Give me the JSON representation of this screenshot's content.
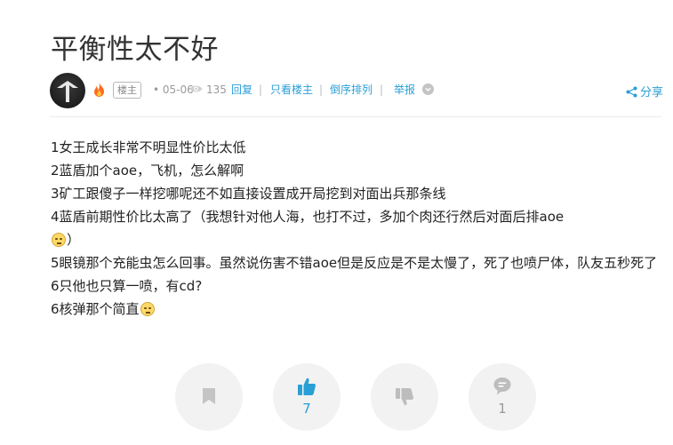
{
  "post": {
    "title": "平衡性太不好",
    "badge": "楼主",
    "date": "• 05-06",
    "views": "135",
    "reply": "回复",
    "only_op": "只看楼主",
    "reverse": "倒序排列",
    "report": "举报",
    "share": "分享",
    "sep": "|"
  },
  "content": {
    "line1": "1女王成长非常不明显性价比太低",
    "line2": "2蓝盾加个aoe，飞机，怎么解啊",
    "line3": "3矿工跟傻子一样挖哪呢还不如直接设置成开局挖到对面出兵那条线",
    "line4a": "4蓝盾前期性价比太高了（我想针对他人海，也打不过，多加个肉还行然后对面后排aoe",
    "line4b": "）",
    "line5": "5眼镜那个充能虫怎么回事。虽然说伤害不错aoe但是反应是不是太慢了，死了也喷尸体，队友五秒死了6只他也只算一喷，有cd?",
    "line6": "6核弹那个简直"
  },
  "actions": {
    "like_count": "7",
    "comment_count": "1"
  },
  "colors": {
    "link": "#2a9fd6",
    "muted": "#999999",
    "action_bg": "#f2f2f2",
    "action_icon": "#bdbdbd"
  },
  "icons": [
    "fire-icon",
    "eye-icon",
    "chevron-down-icon",
    "share-icon",
    "bookmark-icon",
    "thumbs-up-icon",
    "thumbs-down-icon",
    "comment-icon",
    "grimace-emoji"
  ]
}
